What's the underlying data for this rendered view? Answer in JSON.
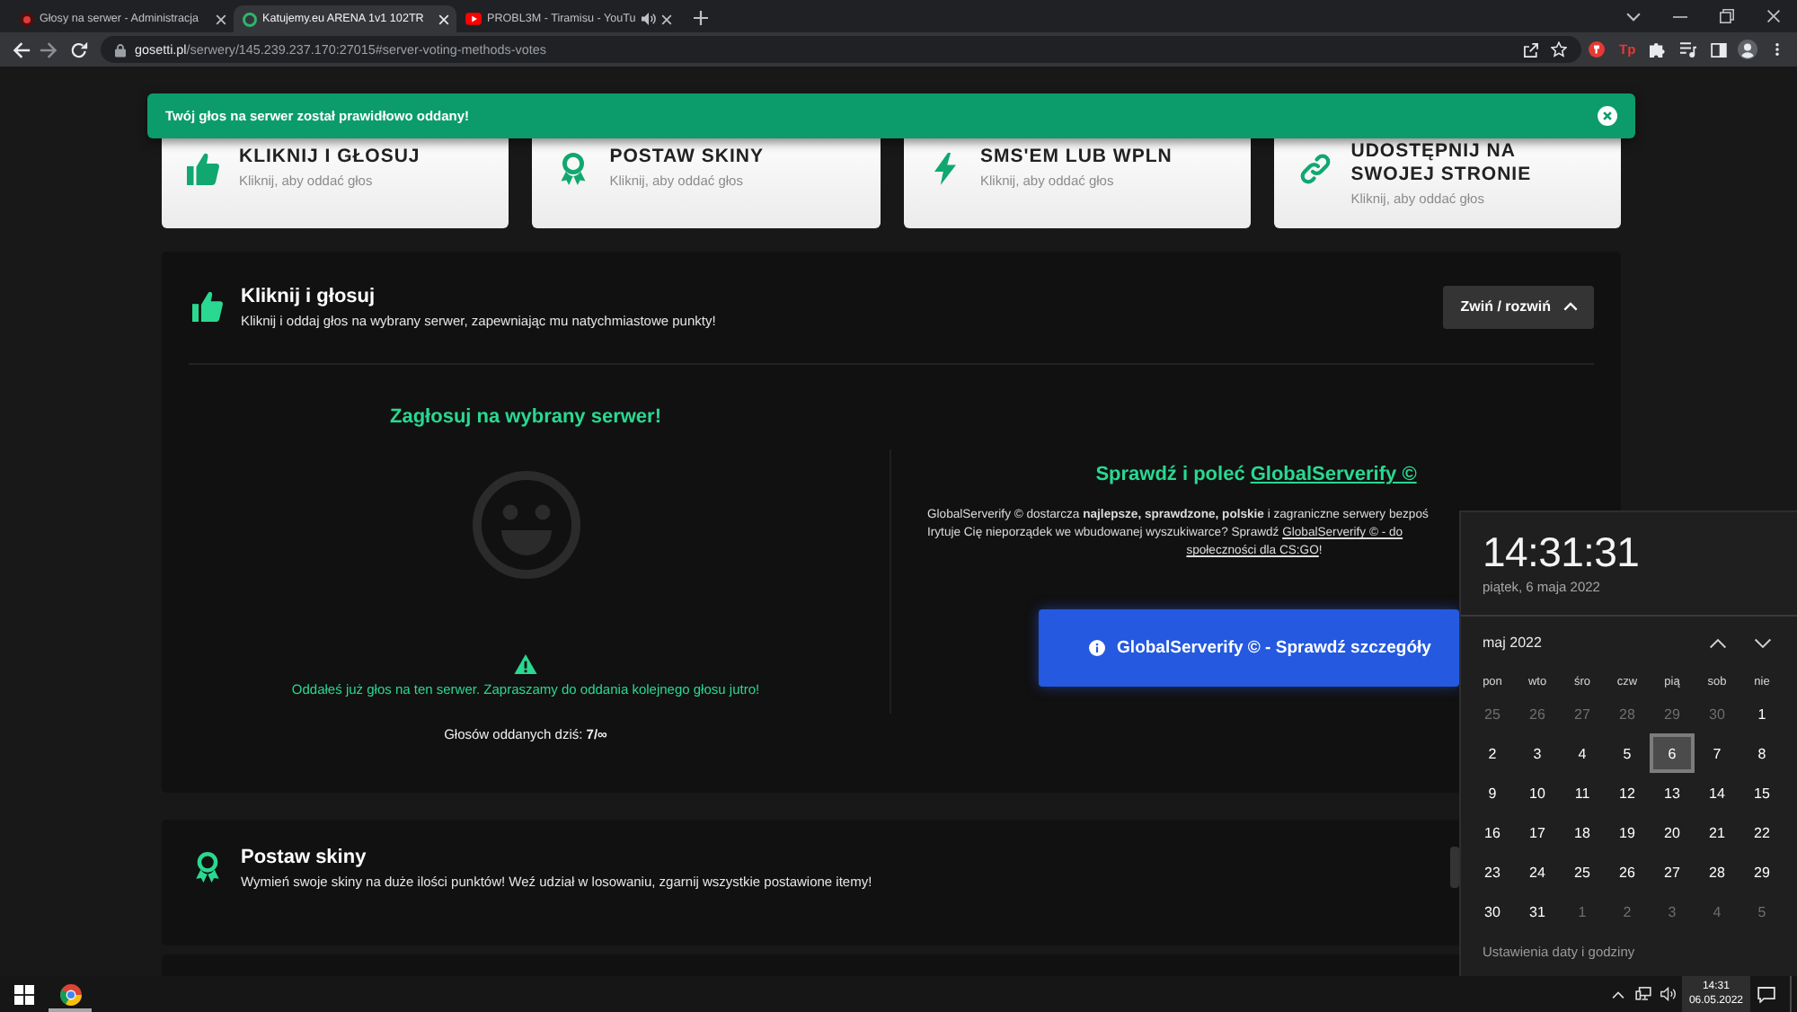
{
  "browser": {
    "tabs": [
      {
        "kind": "site",
        "title": "Głosy na serwer - Administracja",
        "selected": false,
        "audio": false
      },
      {
        "kind": "ring",
        "title": "Katujemy.eu ARENA 1v1 102TR",
        "selected": true,
        "audio": false
      },
      {
        "kind": "video",
        "title": "PROBL3M - Tiramisu - YouTu",
        "selected": false,
        "audio": true
      }
    ],
    "address": {
      "domain": "gosetti.pl",
      "path": "/serwery/145.239.237.170:27015#server-voting-methods-votes"
    },
    "extension_label": "Tp"
  },
  "notification": {
    "message": "Twój głos na serwer został prawidłowo oddany!"
  },
  "method_cards": [
    {
      "kind": "thumb",
      "title": "KLIKNIJ I GŁOSUJ",
      "subtitle": "Kliknij, aby oddać głos"
    },
    {
      "kind": "award",
      "title": "POSTAW SKINY",
      "subtitle": "Kliknij, aby oddać głos"
    },
    {
      "kind": "bolt",
      "title": "SMS'EM LUB WPLN",
      "subtitle": "Kliknij, aby oddać głos"
    },
    {
      "kind": "link",
      "title": "UDOSTĘPNIJ NA SWOJEJ STRONIE",
      "subtitle": "Kliknij, aby oddać głos"
    }
  ],
  "sections": [
    {
      "kind": "thumb",
      "title": "Kliknij i głosuj",
      "subtitle": "Kliknij i oddaj głos na wybrany serwer, zapewniając mu natychmiastowe punkty!",
      "toggle": "Zwiń / rozwiń",
      "expanded": true,
      "vote": {
        "heading": "Zagłosuj na wybrany serwer!",
        "notice": "Oddałeś już głos na ten serwer. Zapraszamy do oddania kolejnego głosu jutro!",
        "count": "Głosów oddanych dziś: **7/∞**"
      },
      "promo": {
        "heading": "Sprawdź i poleć",
        "heading_link": "GlobalServerify ©",
        "lines": [
          [
            {
              "kind": "text",
              "text": "GlobalServerify © dostarcza **najlepsze, sprawdzone, polskie** i zagraniczne serwery bezpoś"
            }
          ],
          [
            {
              "kind": "text",
              "text": "Irytuje Cię nieporządek we wbudowanej wyszukiwarce? Sprawdź "
            },
            {
              "kind": "link",
              "text": "GlobalServerify © - do"
            }
          ],
          [
            {
              "kind": "link",
              "text": "społeczności dla CS:GO"
            },
            {
              "kind": "text",
              "text": "!"
            }
          ]
        ],
        "button": "GlobalServerify © - Sprawdź szczegóły"
      }
    },
    {
      "kind": "award",
      "title": "Postaw skiny",
      "subtitle": "Wymień swoje skiny na duże ilości punktów! Weź udział w losowaniu, zgarnij wszystkie postawione itemy!",
      "expanded": false
    }
  ],
  "clock": {
    "time": "14:31:31",
    "date": "piątek, 6 maja 2022",
    "month": "maj 2022",
    "weekdays": [
      "pon",
      "wto",
      "śro",
      "czw",
      "pią",
      "sob",
      "nie"
    ],
    "days": [
      {
        "label": "25",
        "outside": true,
        "selected": false
      },
      {
        "label": "26",
        "outside": true,
        "selected": false
      },
      {
        "label": "27",
        "outside": true,
        "selected": false
      },
      {
        "label": "28",
        "outside": true,
        "selected": false
      },
      {
        "label": "29",
        "outside": true,
        "selected": false
      },
      {
        "label": "30",
        "outside": true,
        "selected": false
      },
      {
        "label": "1",
        "outside": false,
        "selected": false
      },
      {
        "label": "2",
        "outside": false,
        "selected": false
      },
      {
        "label": "3",
        "outside": false,
        "selected": false
      },
      {
        "label": "4",
        "outside": false,
        "selected": false
      },
      {
        "label": "5",
        "outside": false,
        "selected": false
      },
      {
        "label": "6",
        "outside": false,
        "selected": true
      },
      {
        "label": "7",
        "outside": false,
        "selected": false
      },
      {
        "label": "8",
        "outside": false,
        "selected": false
      },
      {
        "label": "9",
        "outside": false,
        "selected": false
      },
      {
        "label": "10",
        "outside": false,
        "selected": false
      },
      {
        "label": "11",
        "outside": false,
        "selected": false
      },
      {
        "label": "12",
        "outside": false,
        "selected": false
      },
      {
        "label": "13",
        "outside": false,
        "selected": false
      },
      {
        "label": "14",
        "outside": false,
        "selected": false
      },
      {
        "label": "15",
        "outside": false,
        "selected": false
      },
      {
        "label": "16",
        "outside": false,
        "selected": false
      },
      {
        "label": "17",
        "outside": false,
        "selected": false
      },
      {
        "label": "18",
        "outside": false,
        "selected": false
      },
      {
        "label": "19",
        "outside": false,
        "selected": false
      },
      {
        "label": "20",
        "outside": false,
        "selected": false
      },
      {
        "label": "21",
        "outside": false,
        "selected": false
      },
      {
        "label": "22",
        "outside": false,
        "selected": false
      },
      {
        "label": "23",
        "outside": false,
        "selected": false
      },
      {
        "label": "24",
        "outside": false,
        "selected": false
      },
      {
        "label": "25",
        "outside": false,
        "selected": false
      },
      {
        "label": "26",
        "outside": false,
        "selected": false
      },
      {
        "label": "27",
        "outside": false,
        "selected": false
      },
      {
        "label": "28",
        "outside": false,
        "selected": false
      },
      {
        "label": "29",
        "outside": false,
        "selected": false
      },
      {
        "label": "30",
        "outside": false,
        "selected": false
      },
      {
        "label": "31",
        "outside": false,
        "selected": false
      },
      {
        "label": "1",
        "outside": true,
        "selected": false
      },
      {
        "label": "2",
        "outside": true,
        "selected": false
      },
      {
        "label": "3",
        "outside": true,
        "selected": false
      },
      {
        "label": "4",
        "outside": true,
        "selected": false
      },
      {
        "label": "5",
        "outside": true,
        "selected": false
      }
    ],
    "settings": "Ustawienia daty i godziny"
  },
  "taskbar": {
    "apps": [
      {
        "kind": "browser",
        "running": true
      }
    ],
    "time": "14:31",
    "date": "06.05.2022",
    "clock_selected": true
  }
}
